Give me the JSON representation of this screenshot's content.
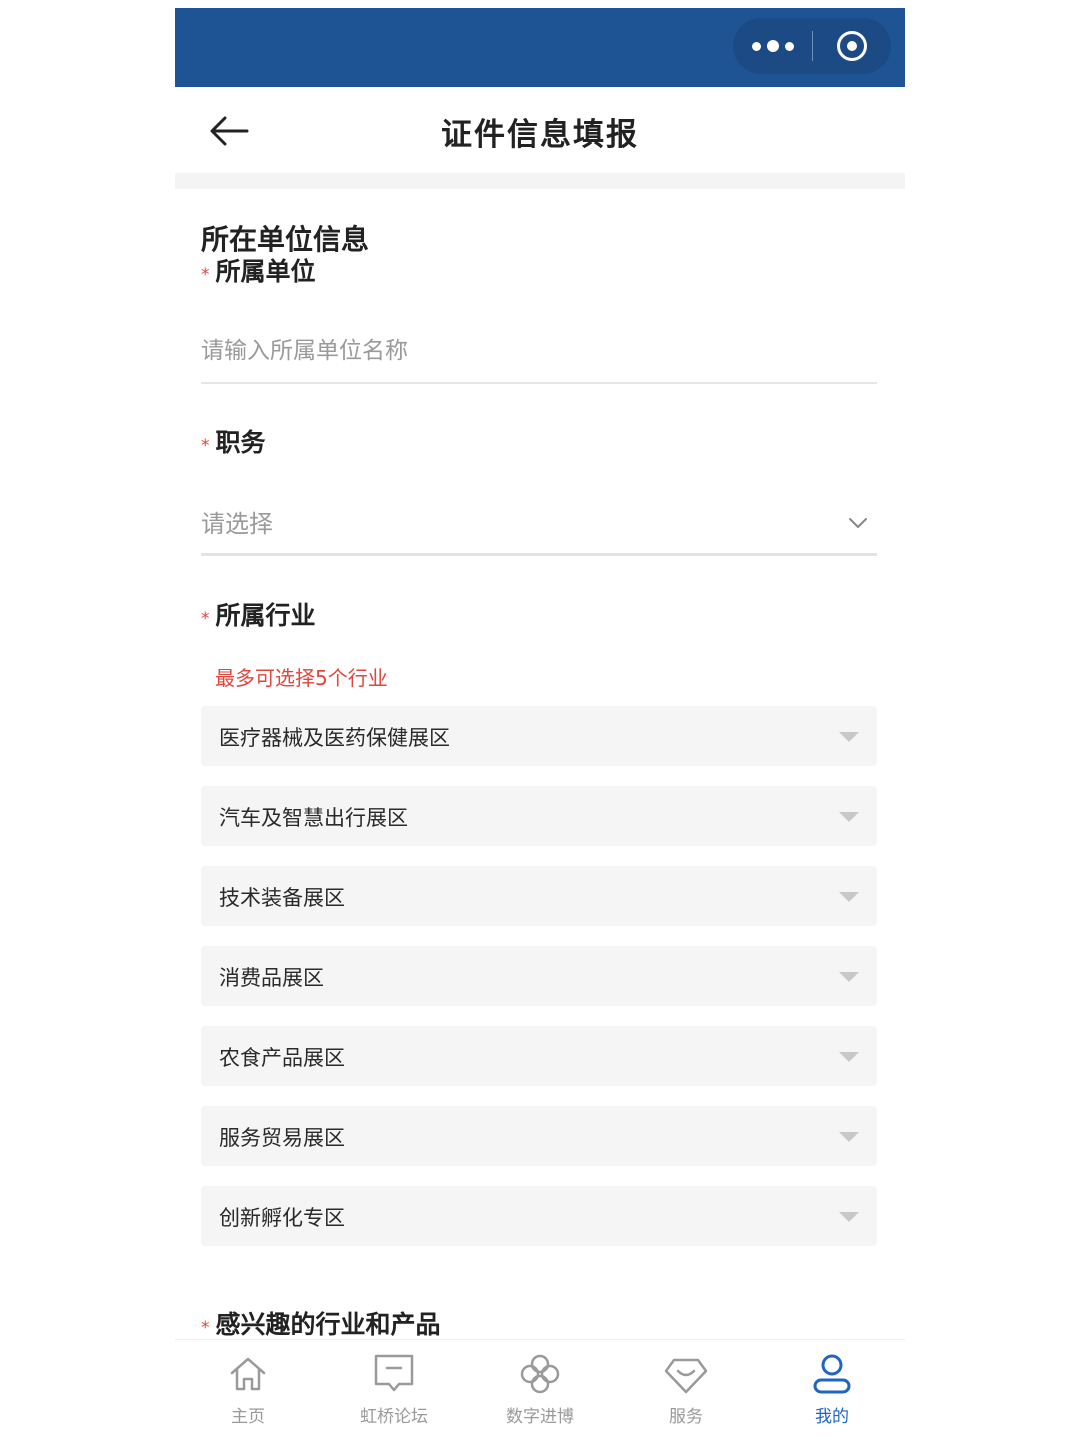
{
  "nav": {
    "title": "证件信息填报"
  },
  "section": {
    "title": "所在单位信息"
  },
  "fields": {
    "required_mark": "*",
    "unit": {
      "label": "所属单位",
      "placeholder": "请输入所属单位名称"
    },
    "position": {
      "label": "职务",
      "placeholder": "请选择"
    },
    "industry": {
      "label": "所属行业",
      "hint": "最多可选择5个行业",
      "options": [
        "医疗器械及医药保健展区",
        "汽车及智慧出行展区",
        "技术装备展区",
        "消费品展区",
        "农食产品展区",
        "服务贸易展区",
        "创新孵化专区"
      ]
    },
    "interest": {
      "label": "感兴趣的行业和产品"
    }
  },
  "tabs": [
    {
      "label": "主页",
      "icon": "home-icon"
    },
    {
      "label": "虹桥论坛",
      "icon": "forum-icon"
    },
    {
      "label": "数字进博",
      "icon": "clover-icon"
    },
    {
      "label": "服务",
      "icon": "diamond-icon"
    },
    {
      "label": "我的",
      "icon": "user-icon",
      "active": true
    }
  ],
  "colors": {
    "topbar": "#1e5494",
    "required": "#e0463c",
    "active_tab": "#1f66c2"
  }
}
